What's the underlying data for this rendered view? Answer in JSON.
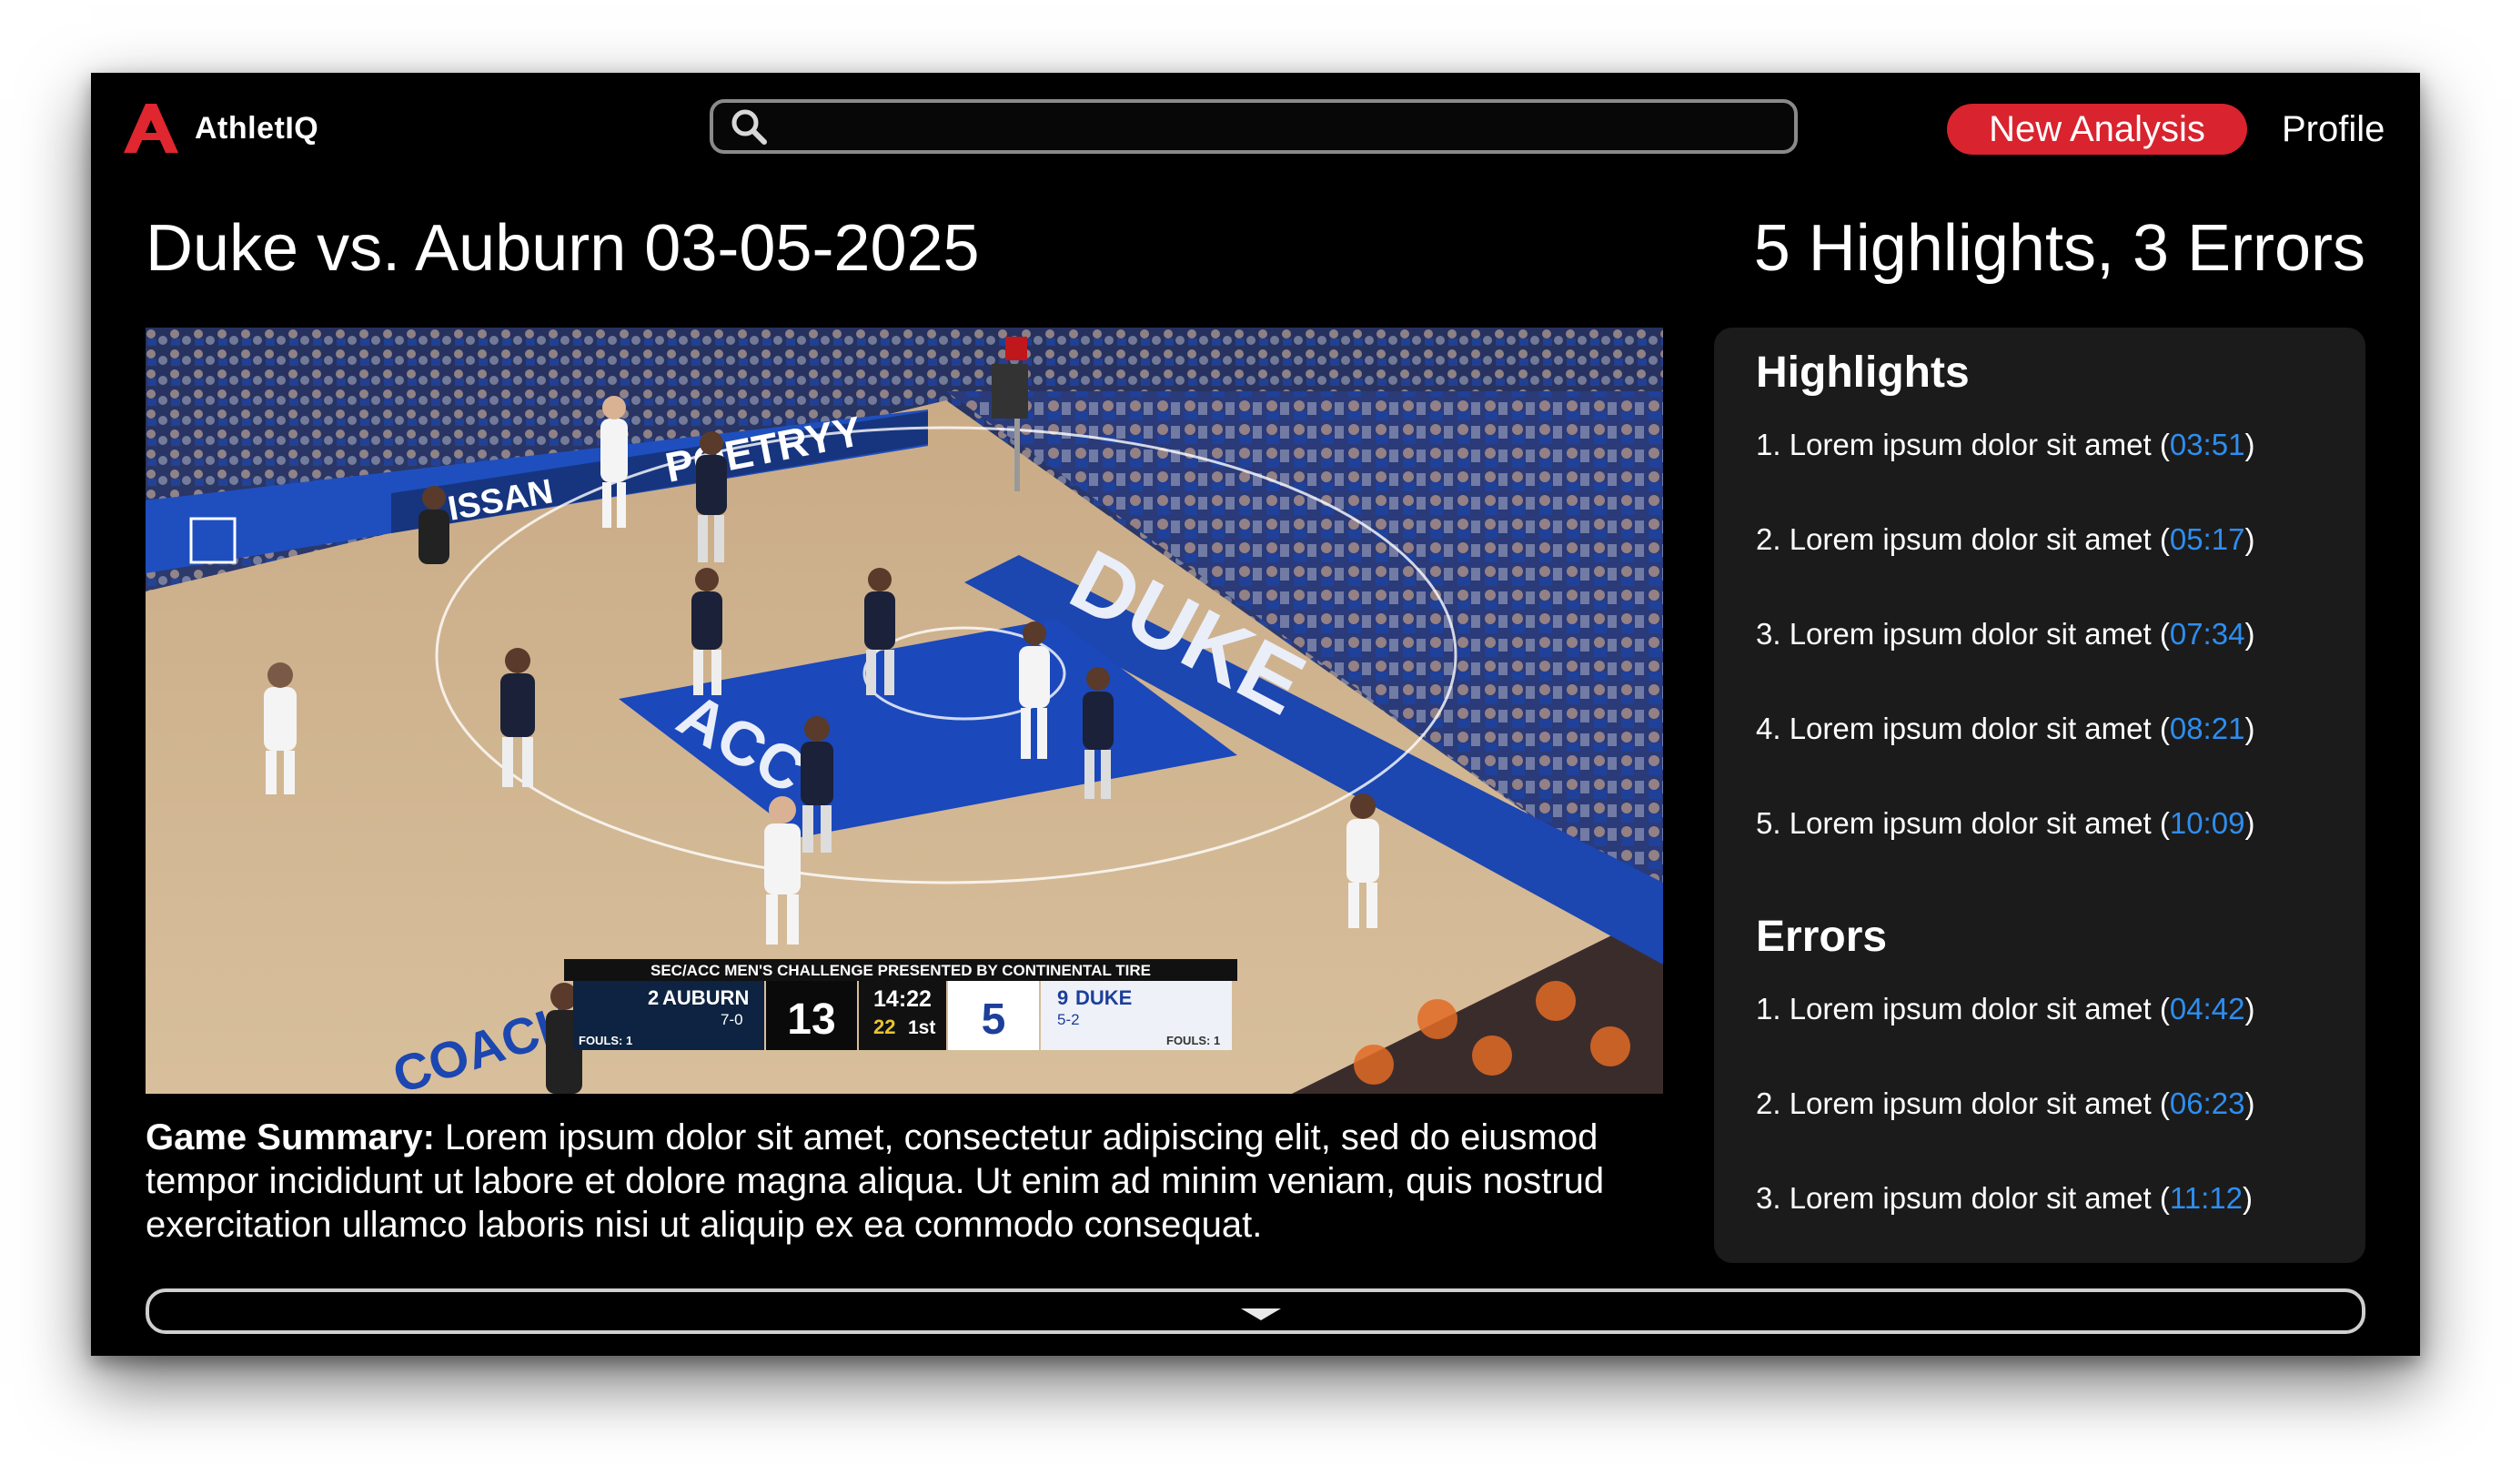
{
  "app": {
    "name": "AthletIQ",
    "logo_icon": "athletiq-logo-icon",
    "accent": "#d9232e",
    "link_color": "#2e8ef0"
  },
  "header": {
    "search": {
      "placeholder": "",
      "value": "",
      "icon": "search-icon"
    },
    "new_analysis_label": "New Analysis",
    "profile_label": "Profile"
  },
  "main": {
    "title": "Duke vs. Auburn 03-05-2025",
    "summary_count": "5 Highlights, 3 Errors",
    "video": {
      "scoreboard": {
        "banner": "SEC/ACC MEN'S CHALLENGE PRESENTED BY CONTINENTAL TIRE",
        "away_rank": "2",
        "away_team": "AUBURN",
        "away_record": "7-0",
        "away_fouls": "FOULS: 1",
        "away_score": "13",
        "clock": "14:22",
        "shot_clock": "22",
        "period": "1st",
        "home_score": "5",
        "home_rank": "9",
        "home_team": "DUKE",
        "home_record": "5-2",
        "home_fouls": "FOULS: 1"
      },
      "court_text": {
        "ad_board_left": "ISSAN",
        "ad_board_right": "POETRYY",
        "baseline": "DUKE",
        "paint": "ACC",
        "sideline": "COACH"
      }
    },
    "game_summary": {
      "label": "Game Summary:",
      "text": " Lorem ipsum dolor sit amet, consectetur adipiscing elit, sed do eiusmod tempor incididunt ut labore et dolore magna aliqua. Ut enim ad minim veniam, quis nostrud exercitation ullamco laboris nisi ut aliquip ex ea commodo consequat."
    }
  },
  "panel": {
    "highlights_heading": "Highlights",
    "highlights": [
      {
        "text": "1. Lorem ipsum dolor sit amet (",
        "time": "03:51",
        "close": ")"
      },
      {
        "text": "2. Lorem ipsum dolor sit amet (",
        "time": "05:17",
        "close": ")"
      },
      {
        "text": "3. Lorem ipsum dolor sit amet (",
        "time": "07:34",
        "close": ")"
      },
      {
        "text": "4. Lorem ipsum dolor sit amet (",
        "time": "08:21",
        "close": ")"
      },
      {
        "text": "5. Lorem ipsum dolor sit amet (",
        "time": "10:09",
        "close": ")"
      }
    ],
    "errors_heading": "Errors",
    "errors": [
      {
        "text": "1. Lorem ipsum dolor sit amet (",
        "time": "04:42",
        "close": ")"
      },
      {
        "text": "2. Lorem ipsum dolor sit amet (",
        "time": "06:23",
        "close": ")"
      },
      {
        "text": "3. Lorem ipsum dolor sit amet (",
        "time": "11:12",
        "close": ")"
      }
    ]
  },
  "footer": {
    "expand_icon": "chevron-down-icon"
  }
}
